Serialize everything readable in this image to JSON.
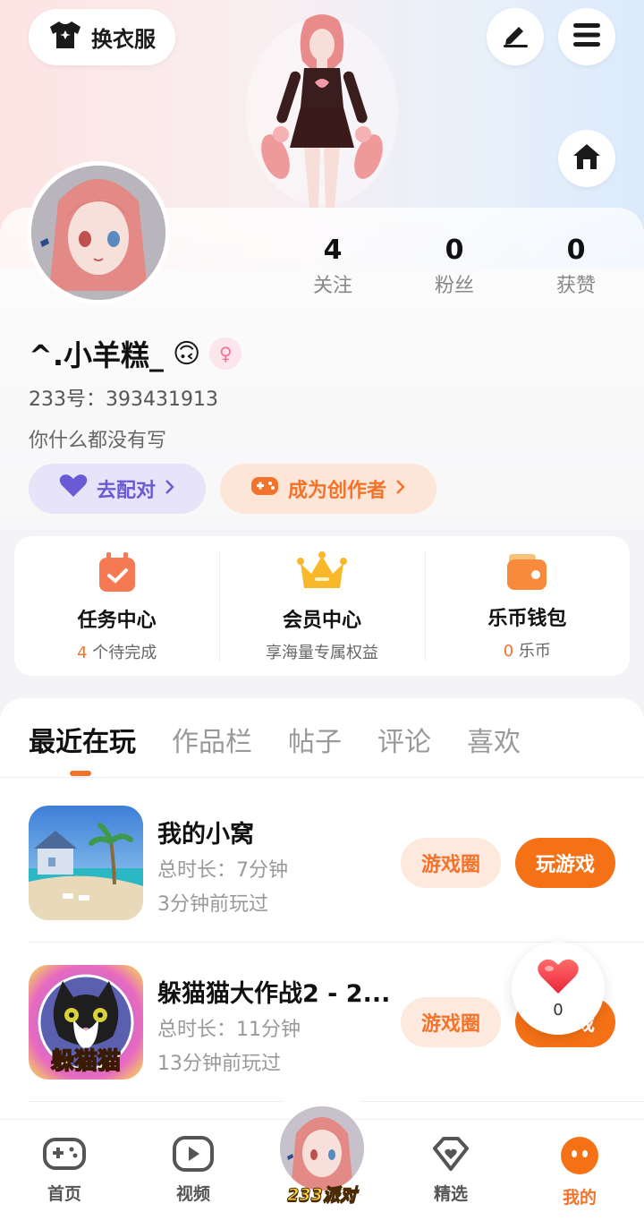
{
  "header": {
    "outfit_label": "换衣服",
    "icons": [
      "shirt-icon",
      "edit-icon",
      "menu-icon",
      "home-icon"
    ]
  },
  "profile": {
    "nickname": "^.小羊糕_",
    "emoji": "🙃",
    "gender_symbol": "♀",
    "uid_text": "233号：393431913",
    "bio": "你什么都没有写",
    "stats": [
      {
        "value": "4",
        "label": "关注"
      },
      {
        "value": "0",
        "label": "粉丝"
      },
      {
        "value": "0",
        "label": "获赞"
      }
    ],
    "match_label": "去配对",
    "creator_label": "成为创作者"
  },
  "services": [
    {
      "title": "任务中心",
      "highlight": "4",
      "sub": " 个待完成"
    },
    {
      "title": "会员中心",
      "highlight": "",
      "sub": "享海量专属权益"
    },
    {
      "title": "乐币钱包",
      "highlight": "0",
      "sub": " 乐币"
    }
  ],
  "tabs": [
    "最近在玩",
    "作品栏",
    "帖子",
    "评论",
    "喜欢"
  ],
  "games": [
    {
      "name": "我的小窝",
      "duration": "总时长：7分钟",
      "last_played": "3分钟前玩过",
      "circle_label": "游戏圈",
      "play_label": "玩游戏"
    },
    {
      "name": "躲猫猫大作战2 - 2...",
      "duration": "总时长：11分钟",
      "last_played": "13分钟前玩过",
      "circle_label": "游戏圈",
      "play_label": "玩游戏",
      "icon_text": "躲猫猫"
    }
  ],
  "like_bubble": {
    "count": "0"
  },
  "bottom_nav": [
    {
      "label": "首页"
    },
    {
      "label": "视频"
    },
    {
      "label": "233派对"
    },
    {
      "label": "精选"
    },
    {
      "label": "我的"
    }
  ],
  "colors": {
    "accent": "#f3732a",
    "play_button": "#f57116",
    "match_purple": "#6a5bd4"
  }
}
